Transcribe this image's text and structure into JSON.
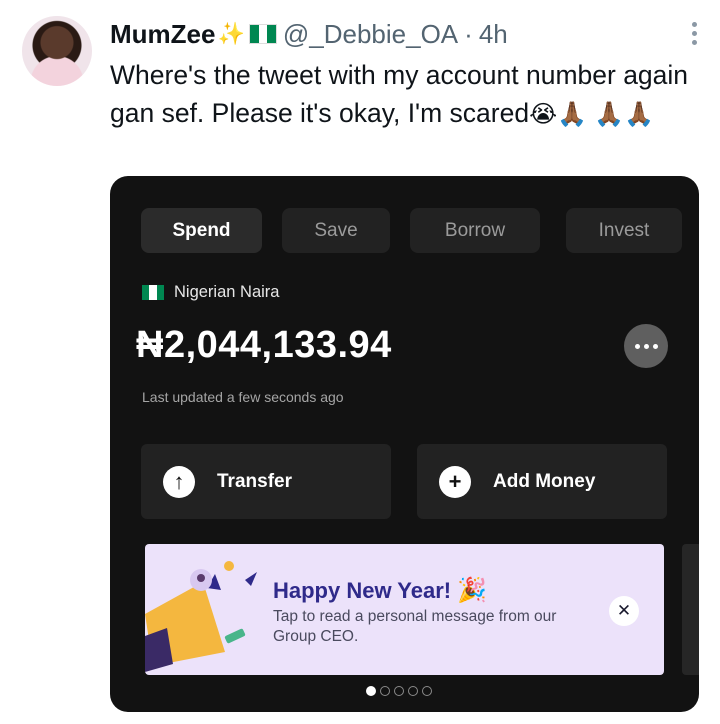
{
  "tweet": {
    "display_name": "MumZee",
    "name_emoji": "✨",
    "handle": "@_Debbie_OA",
    "separator": "·",
    "time": "4h",
    "text": "Where's the tweet with my account number again gan sef. Please it's okay, I'm scared",
    "emojis": [
      "😭",
      "🙏🏾",
      "🙏🏾",
      "🙏🏾"
    ],
    "flag_colors": [
      "#008751",
      "#ffffff",
      "#008751"
    ]
  },
  "app": {
    "tabs": [
      {
        "label": "Spend",
        "active": true
      },
      {
        "label": "Save",
        "active": false
      },
      {
        "label": "Borrow",
        "active": false
      },
      {
        "label": "Invest",
        "active": false
      }
    ],
    "currency_name": "Nigerian Naira",
    "balance": "₦2,044,133.94",
    "last_updated": "Last updated a few seconds ago",
    "actions": [
      {
        "label": "Transfer",
        "icon": "arrow-up-icon",
        "symbol": "↑"
      },
      {
        "label": "Add Money",
        "icon": "plus-icon",
        "symbol": "+"
      }
    ],
    "banner": {
      "title": "Happy New Year!",
      "title_emoji": "🎉",
      "body": "Tap to read a personal message from our Group CEO.",
      "close_symbol": "✕"
    },
    "carousel": {
      "count": 5,
      "active_index": 0
    },
    "colors": {
      "card_bg": "#121212",
      "banner_bg": "#ece2fa",
      "banner_title": "#2f2a8a",
      "megaphone": "#f4b73f"
    }
  }
}
